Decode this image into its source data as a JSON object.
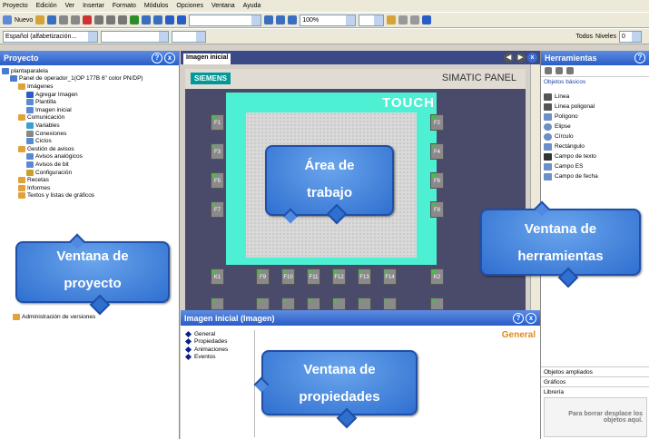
{
  "menu": [
    "Proyecto",
    "Edición",
    "Ver",
    "Insertar",
    "Formato",
    "Módulos",
    "Opciones",
    "Ventana",
    "Ayuda"
  ],
  "toolbar": {
    "new_label": "Nuevo",
    "zoom": "100%",
    "font_combo": "Español (alfabetización...",
    "all_label": "Todos",
    "levels_label": "Niveles",
    "level_value": "0"
  },
  "project": {
    "title": "Proyecto",
    "tree": [
      {
        "label": "plantaparalela",
        "level": 0,
        "icon": "project-icon"
      },
      {
        "label": "Panel de operador_1(OP 177B 6\" color PN/DP)",
        "level": 1,
        "icon": "panel-icon"
      },
      {
        "label": "Imágenes",
        "level": 2,
        "icon": "folder-icon"
      },
      {
        "label": "Agregar Imagen",
        "level": 3,
        "icon": "add-image-icon"
      },
      {
        "label": "Plantilla",
        "level": 3,
        "icon": "image-icon"
      },
      {
        "label": "Imagen inicial",
        "level": 3,
        "icon": "image-icon"
      },
      {
        "label": "Comunicación",
        "level": 2,
        "icon": "folder-icon"
      },
      {
        "label": "Variables",
        "level": 3,
        "icon": "variables-icon"
      },
      {
        "label": "Conexiones",
        "level": 3,
        "icon": "connections-icon"
      },
      {
        "label": "Ciclos",
        "level": 3,
        "icon": "cycles-icon"
      },
      {
        "label": "Gestión de avisos",
        "level": 2,
        "icon": "folder-icon"
      },
      {
        "label": "Avisos analógicos",
        "level": 3,
        "icon": "alarm-icon"
      },
      {
        "label": "Avisos de bit",
        "level": 3,
        "icon": "alarm-icon"
      },
      {
        "label": "Configuración",
        "level": 3,
        "icon": "config-icon"
      },
      {
        "label": "Recetas",
        "level": 2,
        "icon": "folder-icon"
      },
      {
        "label": "Informes",
        "level": 2,
        "icon": "folder-icon"
      },
      {
        "label": "Textos y listas de gráficos",
        "level": 2,
        "icon": "folder-icon"
      }
    ],
    "bottom_item": "Administración de versiones"
  },
  "workarea": {
    "tab": "Imagen inicial",
    "brand": "SIEMENS",
    "panel_name": "SIMATIC PANEL",
    "touch": "TOUCH",
    "left_keys": [
      "F1",
      "F3",
      "F5",
      "F7"
    ],
    "right_keys": [
      "F2",
      "F4",
      "F6",
      "F8"
    ],
    "bottom_keys": [
      "K1",
      "F9",
      "F10",
      "F11",
      "F12",
      "F13",
      "F14",
      "K2"
    ]
  },
  "properties": {
    "title": "Imagen inicial (Imagen)",
    "nav": [
      "General",
      "Propiedades",
      "Animaciones",
      "Eventos"
    ],
    "heading": "General"
  },
  "tools": {
    "title": "Herramientas",
    "basic": "Objetos básicos",
    "items": [
      "Línea",
      "Línea poligonal",
      "Polígono",
      "Elipse",
      "Círculo",
      "Rectángulo",
      "Campo de texto",
      "Campo ES",
      "Campo de fecha"
    ],
    "sections": [
      "Objetos ampliados",
      "Gráficos",
      "Librería"
    ],
    "drop_hint": "Para borrar desplace los objetos aquí."
  },
  "callouts": {
    "project": [
      "Ventana de",
      "proyecto"
    ],
    "work": [
      "Área de",
      "trabajo"
    ],
    "tools": [
      "Ventana de",
      "herramientas"
    ],
    "props": [
      "Ventana de",
      "propiedades"
    ]
  },
  "colors": {
    "accent": "#2f6fd0",
    "panel_cyan": "#4df0d2",
    "hmi_frame": "#4a4a6a",
    "siemens_teal": "#009999"
  }
}
